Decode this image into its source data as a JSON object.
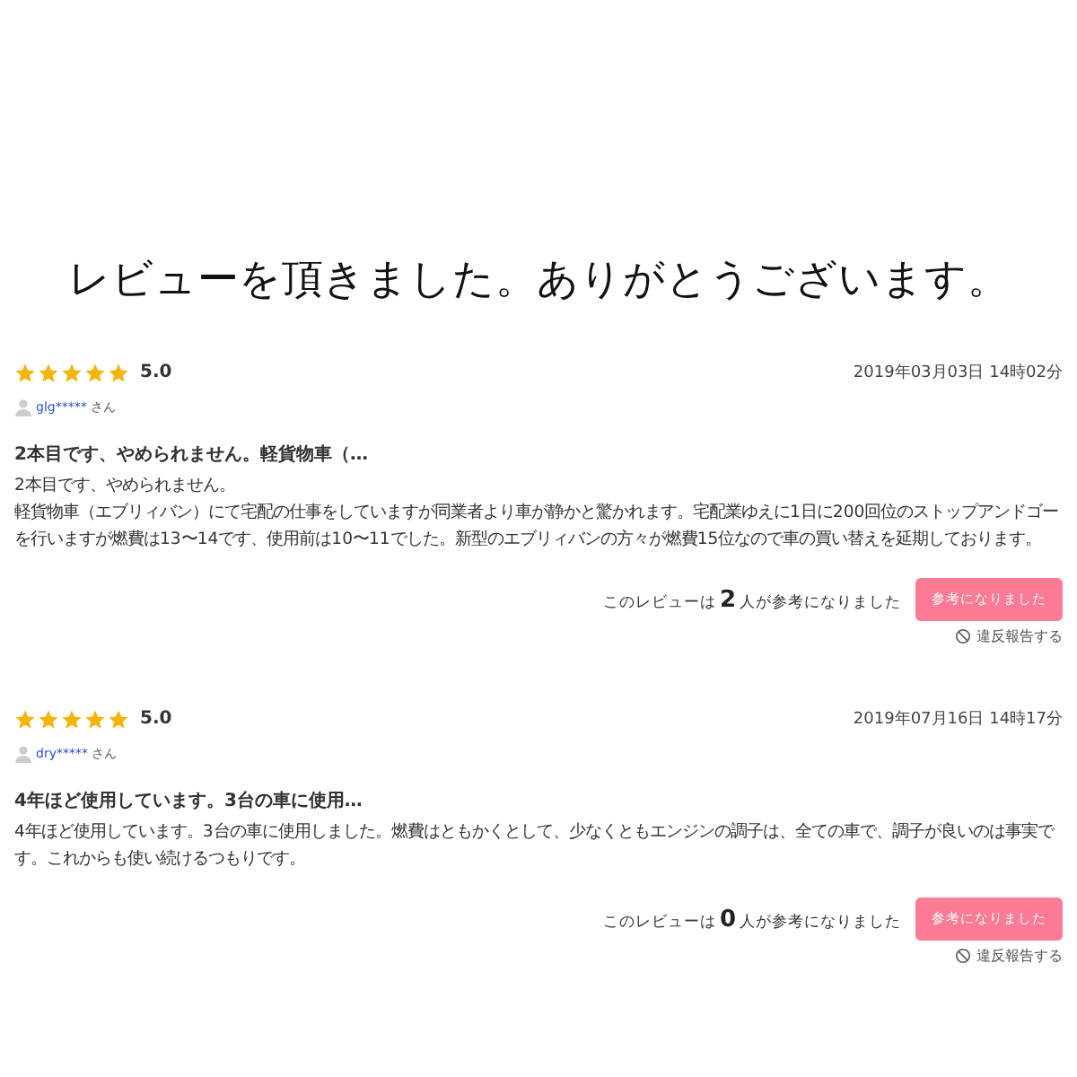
{
  "heading": "レビューを頂きました。ありがとうございます。",
  "reviews": [
    {
      "stars": 5,
      "rating": "5.0",
      "date": "2019年03月03日 14時02分",
      "user": "glg*****",
      "user_suffix": "さん",
      "title": "2本目です、やめられません。軽貨物車（…",
      "body": [
        "2本目です、やめられません。",
        "軽貨物車（エブリィバン）にて宅配の仕事をしていますが同業者より車が静かと驚かれます。宅配業ゆえに1日に200回位のストップアンドゴーを行いますが燃費は13〜14です、使用前は10〜11でした。新型のエブリィバンの方々が燃費15位なので車の買い替えを延期しております。"
      ],
      "helpful": "このレビューは**2**人が参考になりました",
      "helpful_button": "参考になりました",
      "report": "違反報告する"
    },
    {
      "stars": 5,
      "rating": "5.0",
      "date": "2019年07月16日 14時17分",
      "user": "dry*****",
      "user_suffix": "さん",
      "title": "4年ほど使用しています。3台の車に使用…",
      "body": [
        "4年ほど使用しています。3台の車に使用しました。燃費はともかくとして、少なくともエンジンの調子は、全ての車で、調子が良いのは事実です。これからも使い続けるつもりです。"
      ],
      "helpful": "このレビューは**0**人が参考になりました",
      "helpful_button": "参考になりました",
      "report": "違反報告する"
    }
  ]
}
